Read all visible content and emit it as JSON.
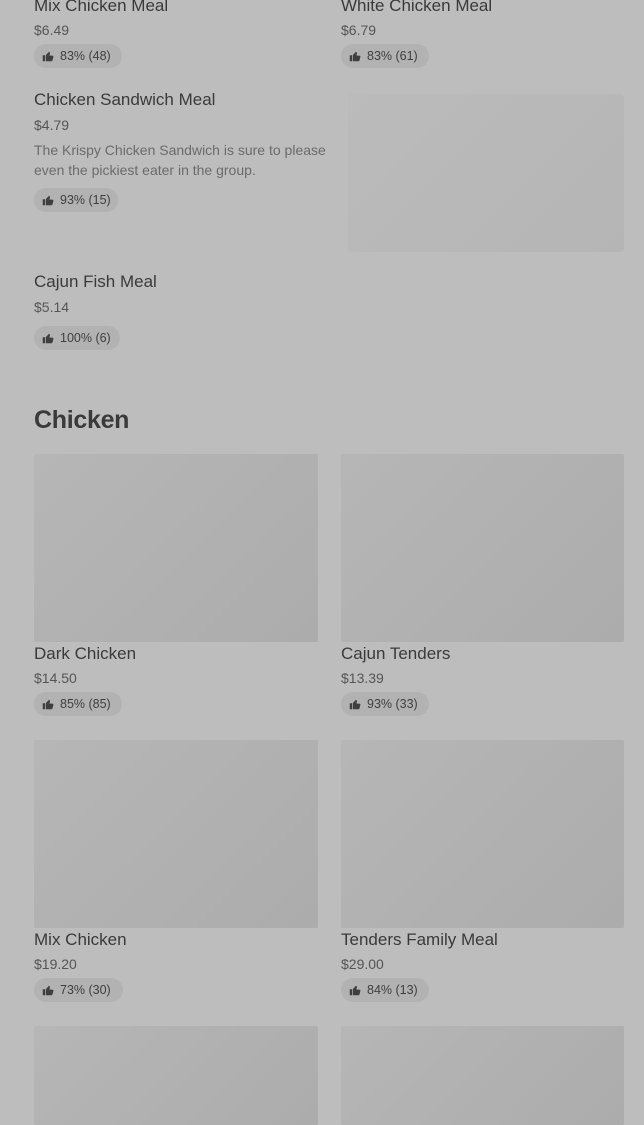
{
  "top_items": [
    {
      "name": "Mix Chicken Meal",
      "price": "$6.49",
      "rating": "83% (48)"
    },
    {
      "name": "White Chicken Meal",
      "price": "$6.79",
      "rating": "83% (61)"
    }
  ],
  "featured": {
    "name": "Chicken Sandwich Meal",
    "price": "$4.79",
    "description": "The Krispy Chicken Sandwich is sure to please even the pickiest eater in the group.",
    "rating": "93% (15)"
  },
  "cajun_fish": {
    "name": "Cajun Fish Meal",
    "price": "$5.14",
    "rating": "100% (6)"
  },
  "section": {
    "title": "Chicken",
    "items": [
      {
        "name": "Dark Chicken",
        "price": "$14.50",
        "rating": "85% (85)"
      },
      {
        "name": "Cajun Tenders",
        "price": "$13.39",
        "rating": "93% (33)"
      },
      {
        "name": "Mix Chicken",
        "price": "$19.20",
        "rating": "73% (30)"
      },
      {
        "name": "Tenders Family Meal",
        "price": "$29.00",
        "rating": "84% (13)"
      }
    ]
  },
  "icons": {
    "rating": "thumbs-up-icon"
  }
}
